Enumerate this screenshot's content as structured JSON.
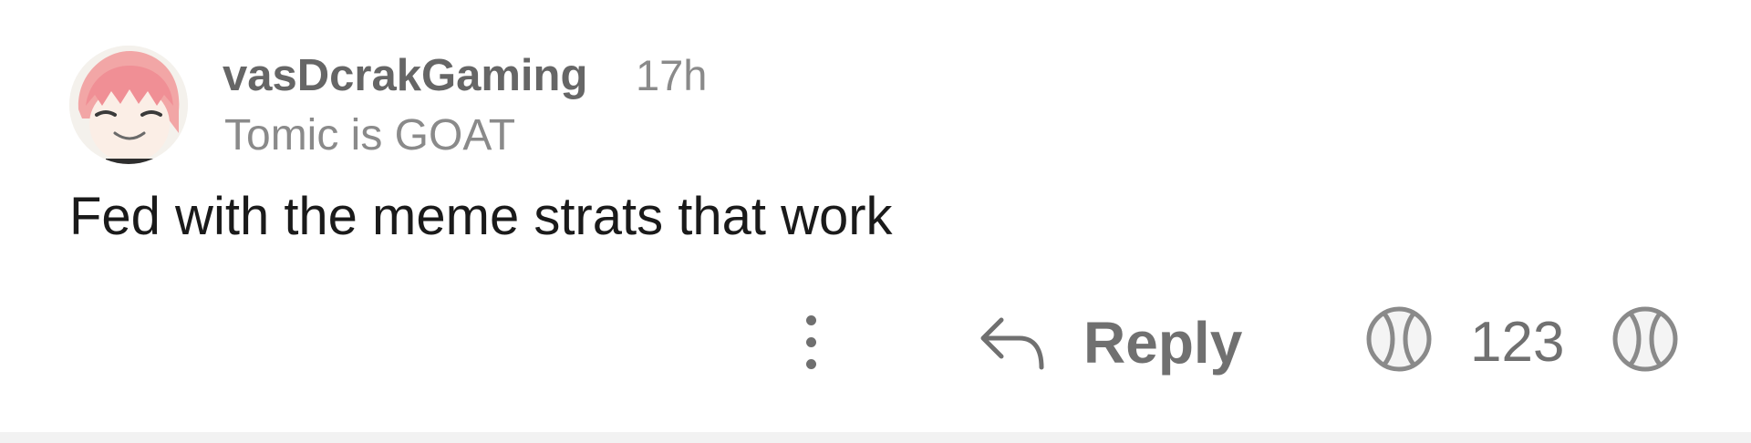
{
  "comment": {
    "author": "vasDcrakGaming",
    "age": "17h",
    "flair": "Tomic is GOAT",
    "body": "Fed with the meme strats that work",
    "avatar_icon": "anime-avatar-icon",
    "actions": {
      "more_icon": "vertical-ellipsis-icon",
      "reply_icon": "reply-arrow-icon",
      "reply_label": "Reply",
      "upvote_icon": "tennis-ball-icon",
      "score": "123",
      "downvote_icon": "tennis-ball-icon"
    }
  },
  "colors": {
    "background": "#ffffff",
    "username": "#666666",
    "meta": "#8a8a8a",
    "body": "#1a1a1a",
    "action": "#707070",
    "avatar_hair": "#f2a6a6",
    "divider": "#f2f2f2"
  }
}
